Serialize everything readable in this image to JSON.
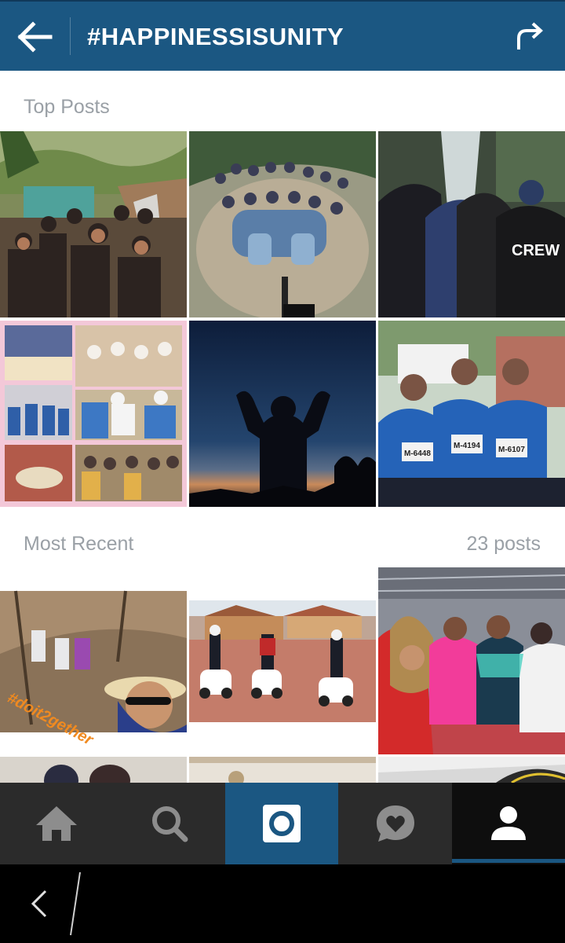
{
  "header": {
    "title": "#HAPPINESSISUNITY",
    "back_icon": "arrow-left-icon",
    "share_icon": "share-arrow-icon",
    "color": "#1b5782"
  },
  "top_posts": {
    "label": "Top Posts"
  },
  "most_recent": {
    "label": "Most Recent",
    "count": "23 posts"
  },
  "tile_text": {
    "crew": "CREW",
    "bib1": "M-6448",
    "bib2": "M-4194",
    "bib3": "M-6107",
    "caption": "#doit2gether"
  },
  "bottom_nav": {
    "items": [
      "home-icon",
      "search-icon",
      "camera-icon",
      "activity-heart-icon",
      "profile-icon"
    ],
    "active_color": "#1b5782"
  },
  "system_nav": {
    "back_icon": "chevron-left-icon"
  }
}
